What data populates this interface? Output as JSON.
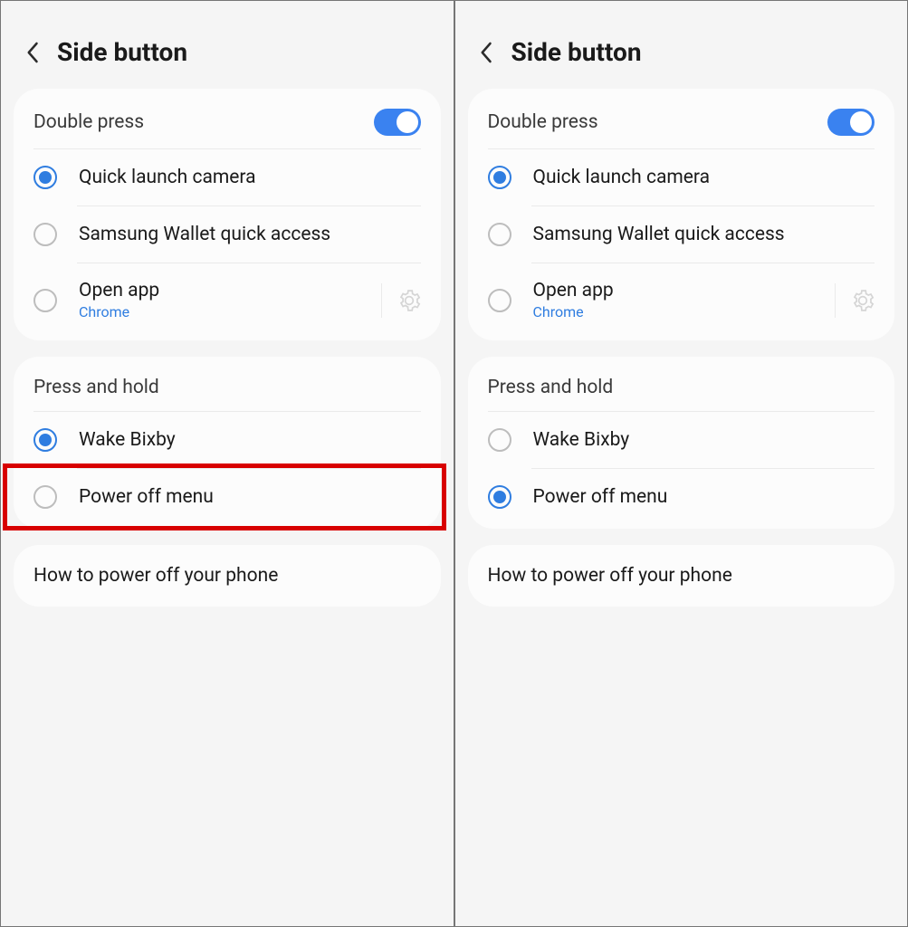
{
  "panels": [
    {
      "title": "Side button",
      "double_press": {
        "label": "Double press",
        "toggle_on": true,
        "options": [
          {
            "label": "Quick launch camera",
            "selected": true,
            "sublabel": null,
            "has_gear": false
          },
          {
            "label": "Samsung Wallet quick access",
            "selected": false,
            "sublabel": null,
            "has_gear": false
          },
          {
            "label": "Open app",
            "selected": false,
            "sublabel": "Chrome",
            "has_gear": true
          }
        ]
      },
      "press_hold": {
        "label": "Press and hold",
        "options": [
          {
            "label": "Wake Bixby",
            "selected": true,
            "highlighted": false
          },
          {
            "label": "Power off menu",
            "selected": false,
            "highlighted": true
          }
        ]
      },
      "help": "How to power off your phone"
    },
    {
      "title": "Side button",
      "double_press": {
        "label": "Double press",
        "toggle_on": true,
        "options": [
          {
            "label": "Quick launch camera",
            "selected": true,
            "sublabel": null,
            "has_gear": false
          },
          {
            "label": "Samsung Wallet quick access",
            "selected": false,
            "sublabel": null,
            "has_gear": false
          },
          {
            "label": "Open app",
            "selected": false,
            "sublabel": "Chrome",
            "has_gear": true
          }
        ]
      },
      "press_hold": {
        "label": "Press and hold",
        "options": [
          {
            "label": "Wake Bixby",
            "selected": false,
            "highlighted": false
          },
          {
            "label": "Power off menu",
            "selected": true,
            "highlighted": false
          }
        ]
      },
      "help": "How to power off your phone"
    }
  ]
}
